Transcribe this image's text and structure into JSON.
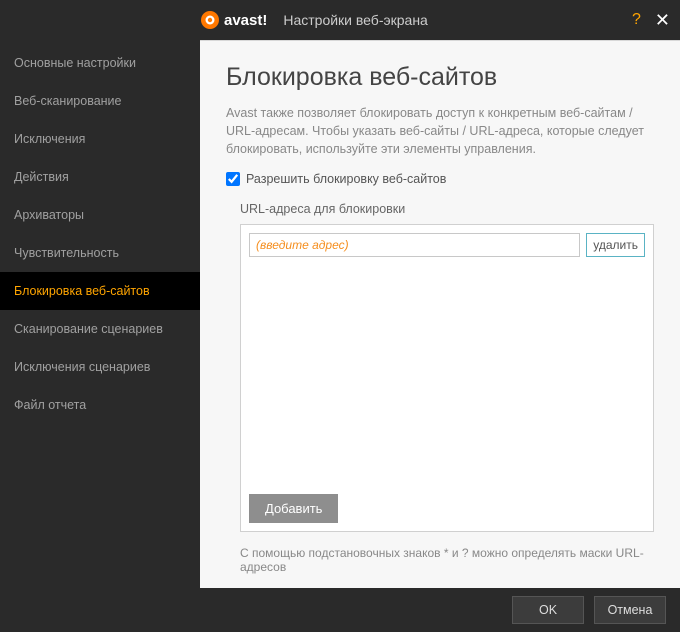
{
  "titlebar": {
    "brand": "avast!",
    "title": "Настройки веб-экрана"
  },
  "sidebar": {
    "items": [
      {
        "label": "Основные настройки"
      },
      {
        "label": "Веб-сканирование"
      },
      {
        "label": "Исключения"
      },
      {
        "label": "Действия"
      },
      {
        "label": "Архиваторы"
      },
      {
        "label": "Чувствительность"
      },
      {
        "label": "Блокировка веб-сайтов"
      },
      {
        "label": "Сканирование сценариев"
      },
      {
        "label": "Исключения сценариев"
      },
      {
        "label": "Файл отчета"
      }
    ],
    "activeIndex": 6
  },
  "page": {
    "title": "Блокировка веб-сайтов",
    "description": "Avast также позволяет блокировать доступ к конкретным веб-сайтам / URL-адресам. Чтобы указать веб-сайты / URL-адреса, которые следует блокировать, используйте эти элементы управления.",
    "enableLabel": "Разрешить блокировку веб-сайтов",
    "urlsLabel": "URL-адреса для блокировки",
    "urlPlaceholder": "(введите адрес)",
    "deleteLabel": "удалить",
    "addLabel": "Добавить",
    "hint": "С помощью подстановочных знаков * и ? можно определять маски URL-адресов"
  },
  "footer": {
    "ok": "OK",
    "cancel": "Отмена"
  }
}
